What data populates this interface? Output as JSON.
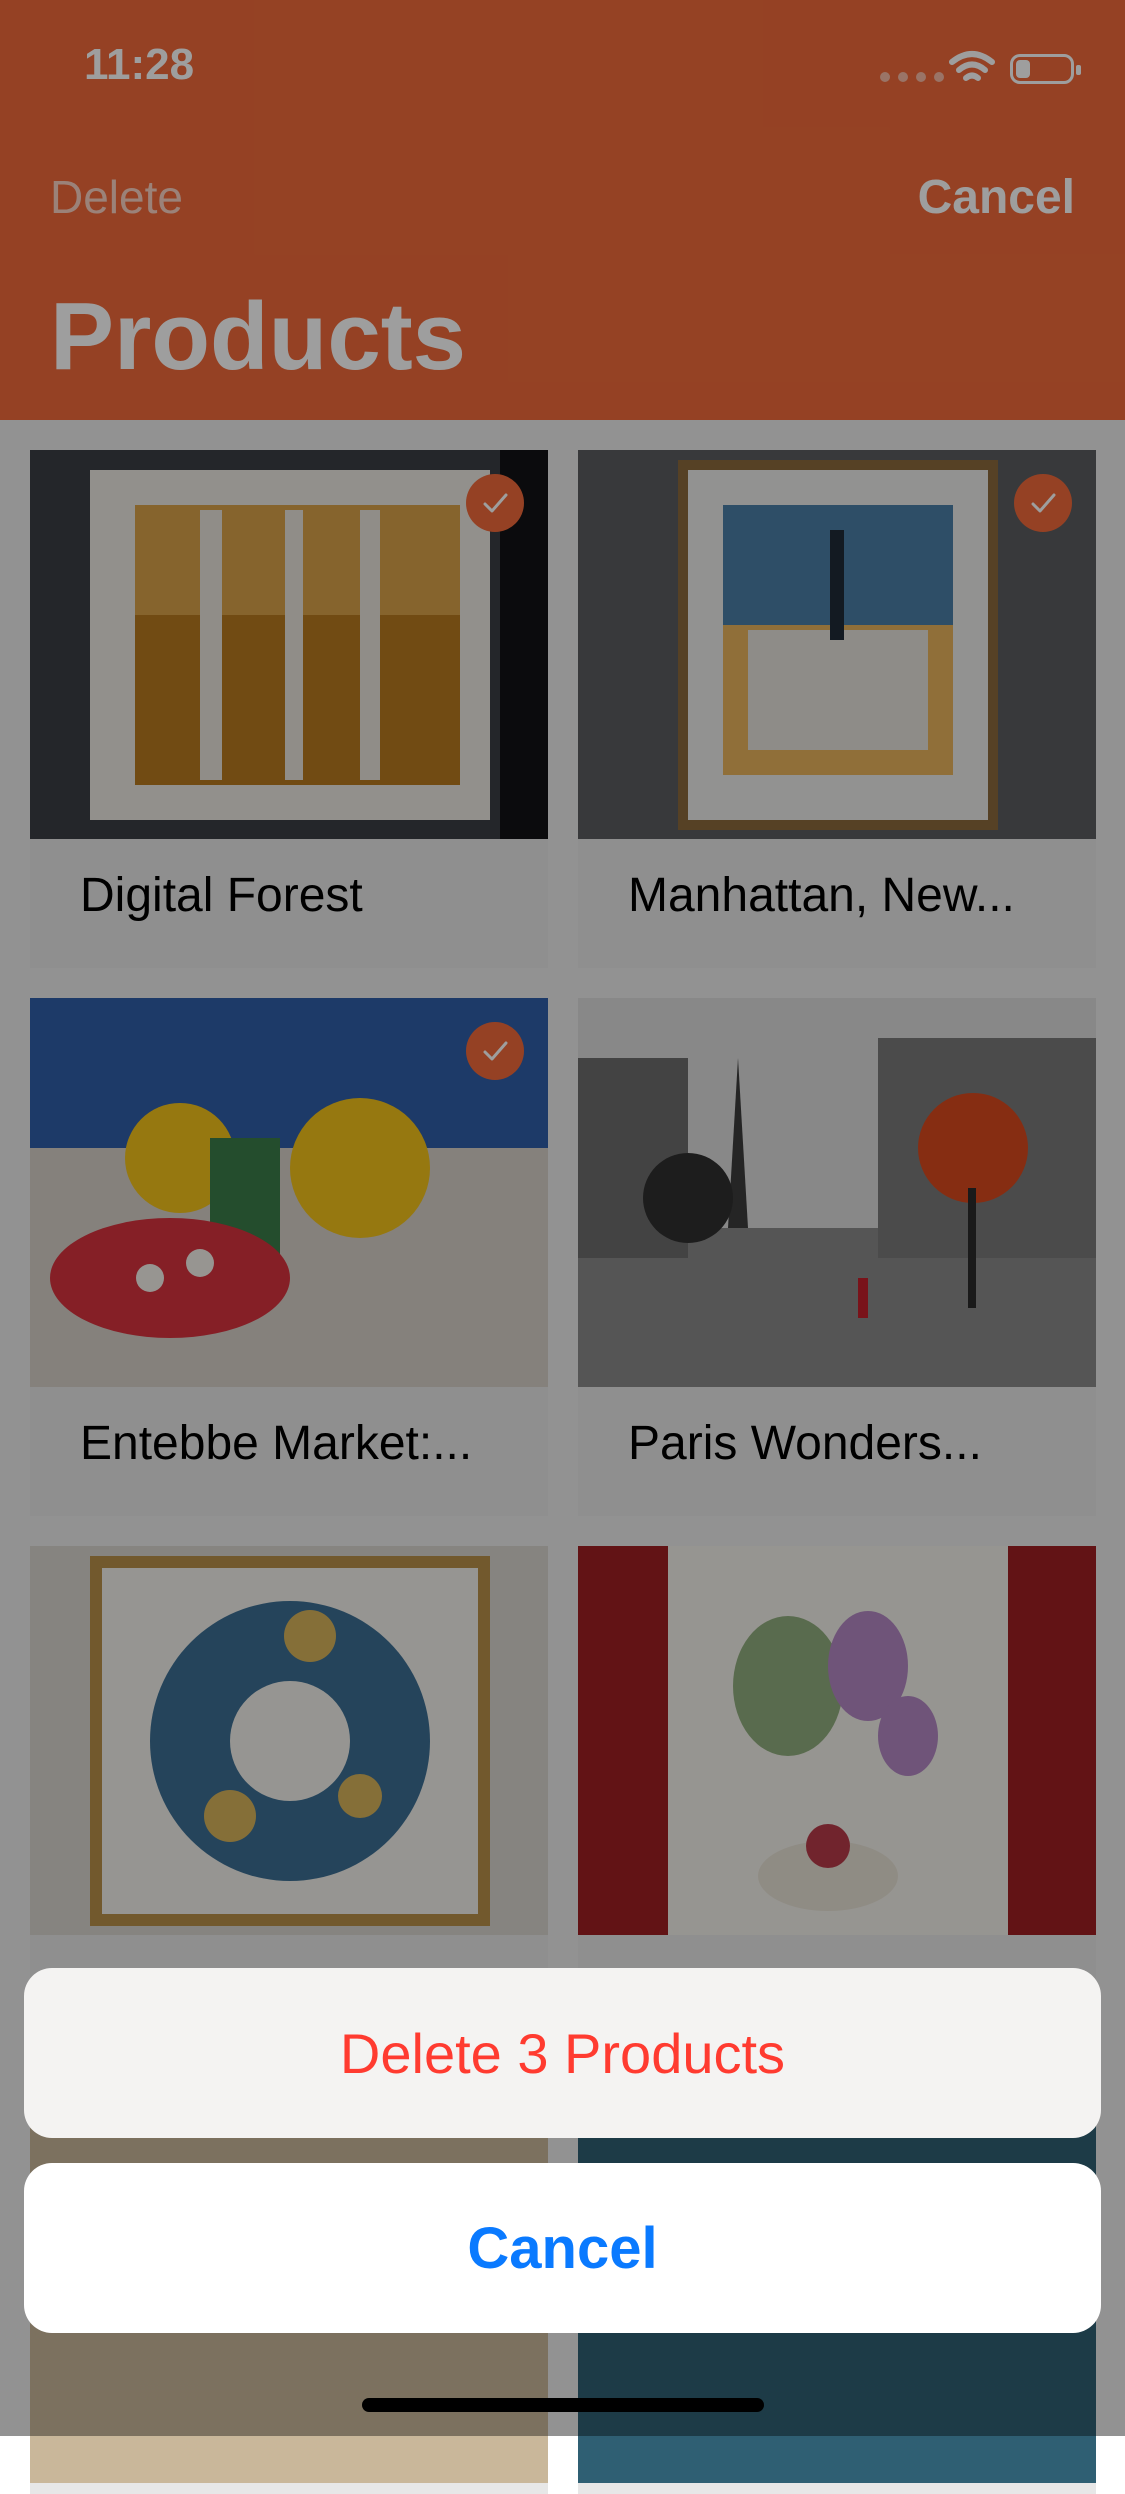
{
  "status_bar": {
    "time": "11:28"
  },
  "nav": {
    "delete_label": "Delete",
    "cancel_label": "Cancel",
    "title": "Products"
  },
  "products": [
    {
      "name": "Digital Forest",
      "selected": true
    },
    {
      "name": "Manhattan, New...",
      "selected": true
    },
    {
      "name": "Entebbe Market:...",
      "selected": true
    },
    {
      "name": "Paris Wonders...",
      "selected": false
    },
    {
      "name": "",
      "selected": false
    },
    {
      "name": "",
      "selected": false
    }
  ],
  "action_sheet": {
    "delete_label": "Delete 3 Products",
    "cancel_label": "Cancel"
  },
  "colors": {
    "accent": "#f06a3a",
    "destructive": "#ff3b30",
    "link": "#0a7aff"
  }
}
